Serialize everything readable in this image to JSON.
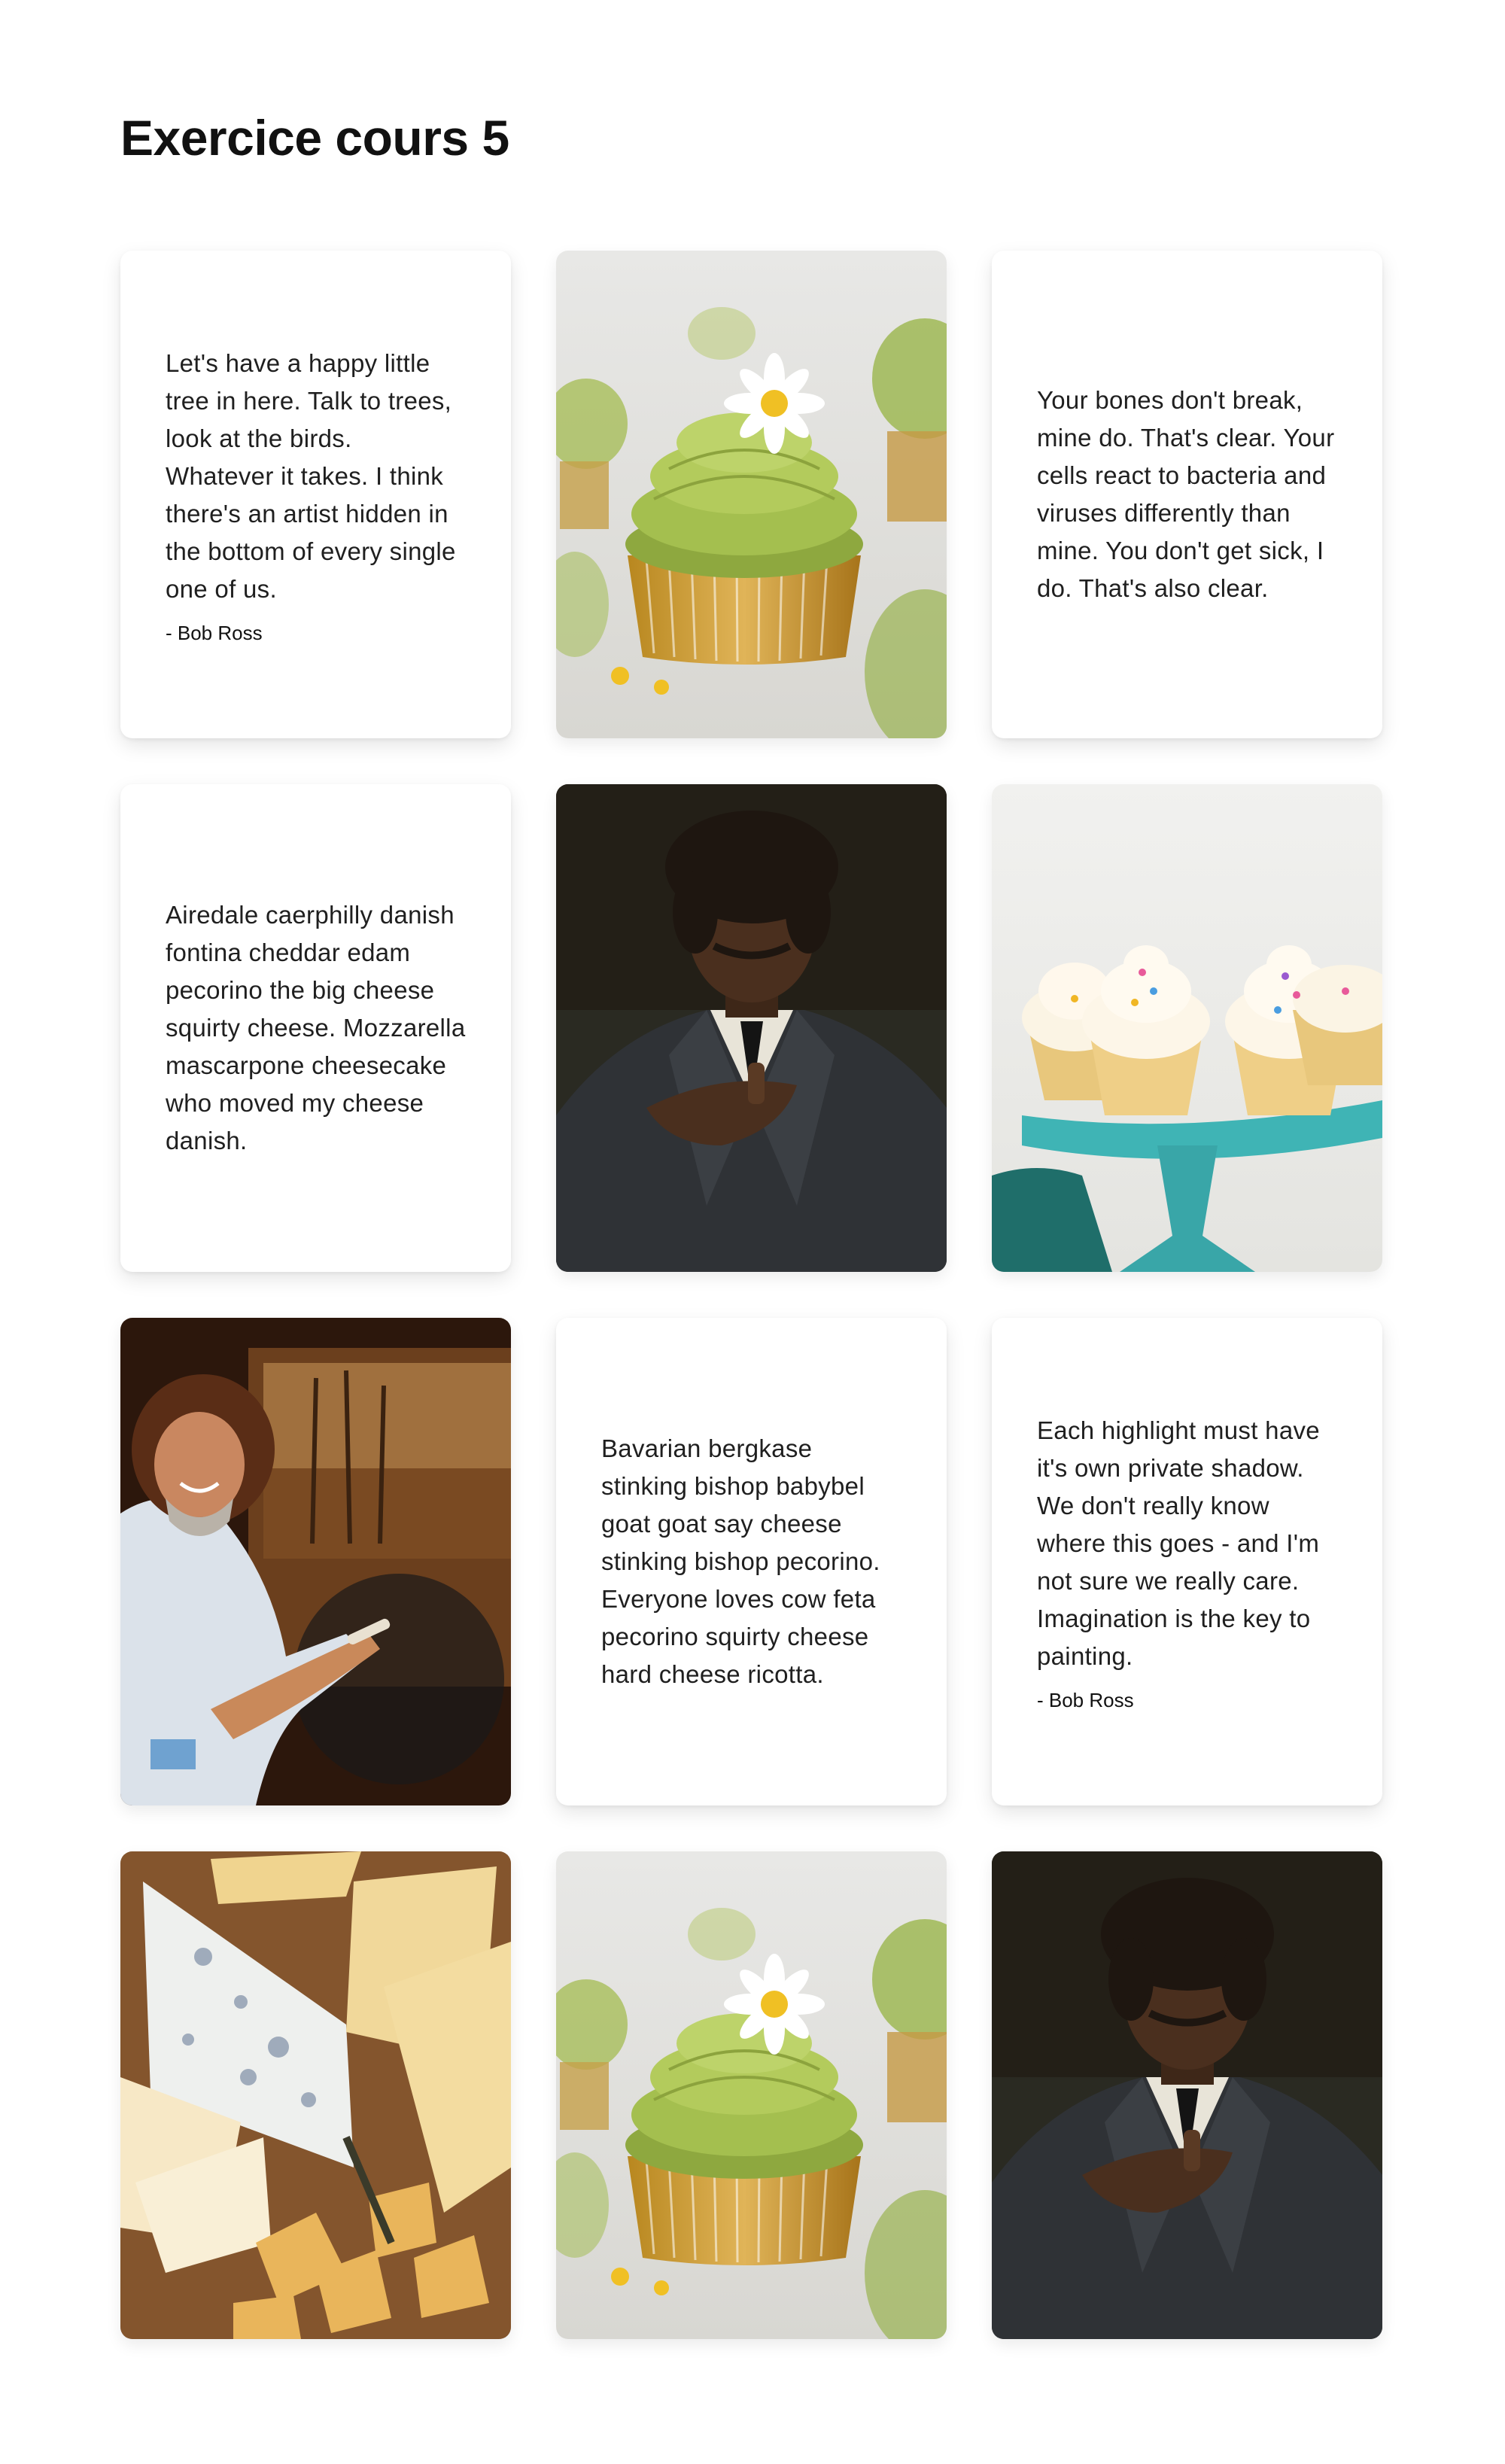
{
  "page": {
    "title": "Exercice cours 5"
  },
  "cards": [
    {
      "kind": "text",
      "text": "Let's have a happy little tree in here. Talk to trees, look at the birds. Whatever it takes. I think there's an artist hidden in the bottom of every single one of us.",
      "author": "- Bob Ross"
    },
    {
      "kind": "image",
      "alt": "Green matcha cupcake with daisy"
    },
    {
      "kind": "text",
      "text": "Your bones don't break, mine do. That's clear. Your cells react to bacteria and viruses differently than mine. You don't get sick, I do. That's also clear."
    },
    {
      "kind": "text",
      "text": "Airedale caerphilly danish fontina cheddar edam pecorino the big cheese squirty cheese. Mozzarella mascarpone cheesecake who moved my cheese danish."
    },
    {
      "kind": "image",
      "alt": "Man in dark suit"
    },
    {
      "kind": "image",
      "alt": "Vanilla cupcakes with sprinkles on a teal cake stand"
    },
    {
      "kind": "image",
      "alt": "Bob Ross painting"
    },
    {
      "kind": "text",
      "text": "Bavarian bergkase stinking bishop babybel goat goat say cheese stinking bishop pecorino. Everyone loves cow feta pecorino squirty cheese hard cheese ricotta."
    },
    {
      "kind": "text",
      "text": "Each highlight must have it's own private shadow. We don't really know where this goes - and I'm not sure we really care. Imagination is the key to painting.",
      "author": "- Bob Ross"
    },
    {
      "kind": "image",
      "alt": "Assorted cheeses on a wooden board"
    },
    {
      "kind": "image",
      "alt": "Green matcha cupcake with daisy"
    },
    {
      "kind": "image",
      "alt": "Man in dark suit"
    }
  ],
  "colors": {
    "background": "#ffffff",
    "text": "#1f1f1f",
    "card_shadow": "rgba(0,0,0,0.10)"
  }
}
